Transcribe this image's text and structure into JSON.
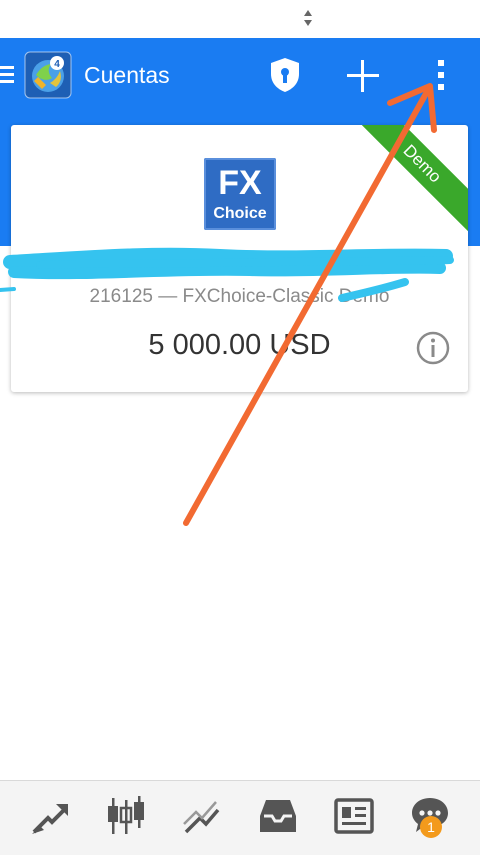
{
  "app_bar": {
    "title": "Cuentas",
    "background_color": "#1a7cf2",
    "icons": [
      "menu-icon",
      "metatrader-logo",
      "shield-keyhole-icon",
      "plus-icon",
      "more-vertical-icon"
    ]
  },
  "account": {
    "ribbon_label": "Demo",
    "ribbon_color": "#3aa82b",
    "broker_logo": {
      "line1": "FX",
      "line2": "Choice",
      "color": "#2f6cc4"
    },
    "name": "",
    "number_line": "216125 — FXChoice-Classic Demo",
    "balance": "5 000.00 USD",
    "info_icon": "info-icon"
  },
  "annotations": {
    "arrow_color": "#f26a32",
    "redaction_color": "#35c3ef"
  },
  "bottom_nav": {
    "items": [
      {
        "icon": "trade-arrows-icon"
      },
      {
        "icon": "candlestick-chart-icon"
      },
      {
        "icon": "trend-line-icon"
      },
      {
        "icon": "inbox-tray-icon"
      },
      {
        "icon": "news-icon"
      },
      {
        "icon": "chat-icon"
      }
    ],
    "chat_badge": "1",
    "badge_color": "#f39a1c"
  }
}
